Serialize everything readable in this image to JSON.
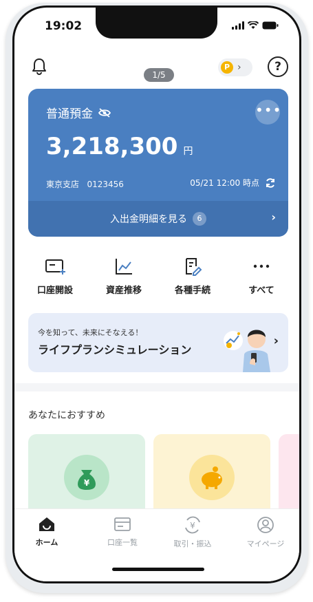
{
  "status": {
    "time": "19:02"
  },
  "header": {
    "pager": "1/5",
    "points_label": "P",
    "help": "?"
  },
  "account": {
    "type": "普通預金",
    "balance": "3,218,300",
    "currency": "円",
    "branch": "東京支店",
    "number": "0123456",
    "as_of": "05/21 12:00 時点",
    "details_label": "入出金明細を見る",
    "details_count": "6",
    "accent": "#4a7fc1"
  },
  "actions": [
    {
      "label": "口座開設",
      "icon": "card-plus-icon"
    },
    {
      "label": "資産推移",
      "icon": "chart-line-icon"
    },
    {
      "label": "各種手続",
      "icon": "document-edit-icon"
    },
    {
      "label": "すべて",
      "icon": "more-dots-icon"
    }
  ],
  "banner": {
    "sub": "今を知って、未来にそなえる！",
    "title": "ライフプランシミュレーション"
  },
  "recommend": {
    "title": "あなたにおすすめ"
  },
  "tabs": [
    {
      "label": "ホーム",
      "icon": "home-icon"
    },
    {
      "label": "口座一覧",
      "icon": "account-list-icon"
    },
    {
      "label": "取引・振込",
      "icon": "yen-transfer-icon"
    },
    {
      "label": "マイページ",
      "icon": "user-icon"
    }
  ]
}
